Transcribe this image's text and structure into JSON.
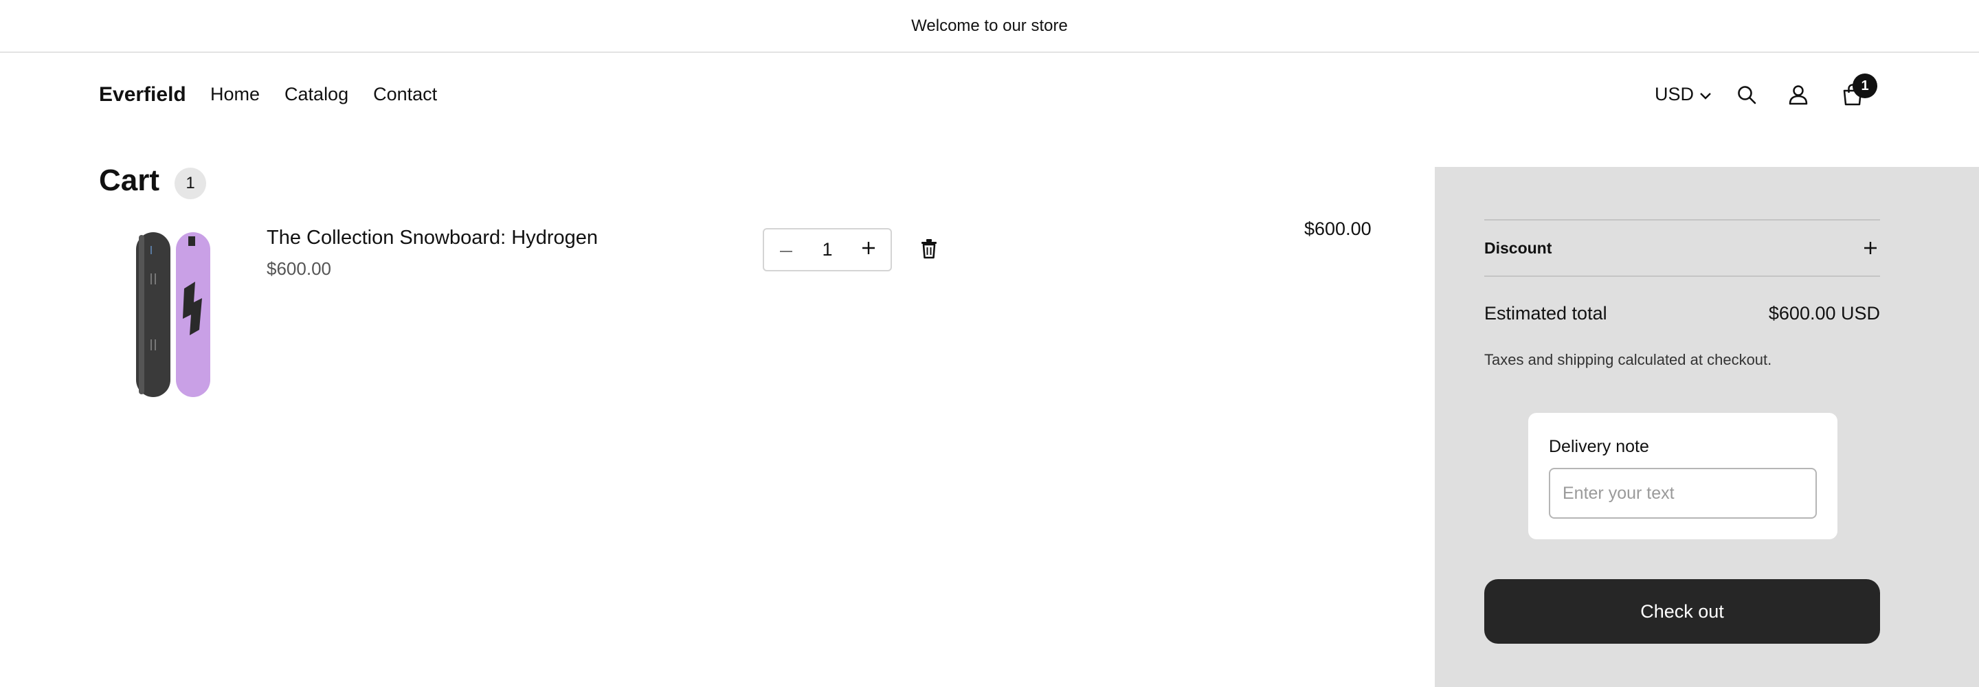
{
  "announcement": {
    "text": "Welcome to our store"
  },
  "header": {
    "logo": "Everfield",
    "nav": [
      "Home",
      "Catalog",
      "Contact"
    ],
    "currency": "USD",
    "cart_count": "1"
  },
  "cart": {
    "title": "Cart",
    "count": "1",
    "items": [
      {
        "title": "The Collection Snowboard: Hydrogen",
        "price": "$600.00",
        "quantity": "1",
        "line_total": "$600.00",
        "image_colors": {
          "board_dark": "#3a3a3a",
          "board_purple": "#c9a0e6"
        }
      }
    ]
  },
  "summary": {
    "discount_label": "Discount",
    "estimated_label": "Estimated total",
    "estimated_value": "$600.00 USD",
    "tax_note": "Taxes and shipping calculated at checkout.",
    "delivery_note_label": "Delivery note",
    "delivery_note_placeholder": "Enter your text",
    "delivery_note_value": "",
    "checkout_label": "Check out"
  },
  "colors": {
    "summary_bg": "#dfdfdf",
    "checkout_bg": "#262626",
    "badge_bg": "#e6e6e6"
  },
  "icons": {
    "search": "search-icon",
    "account": "user-icon",
    "cart": "shopping-bag-icon",
    "currency_toggle": "chevron-down-icon",
    "qty_minus": "minus-icon",
    "qty_plus": "plus-icon",
    "remove": "trash-icon",
    "discount_toggle": "plus-icon"
  }
}
